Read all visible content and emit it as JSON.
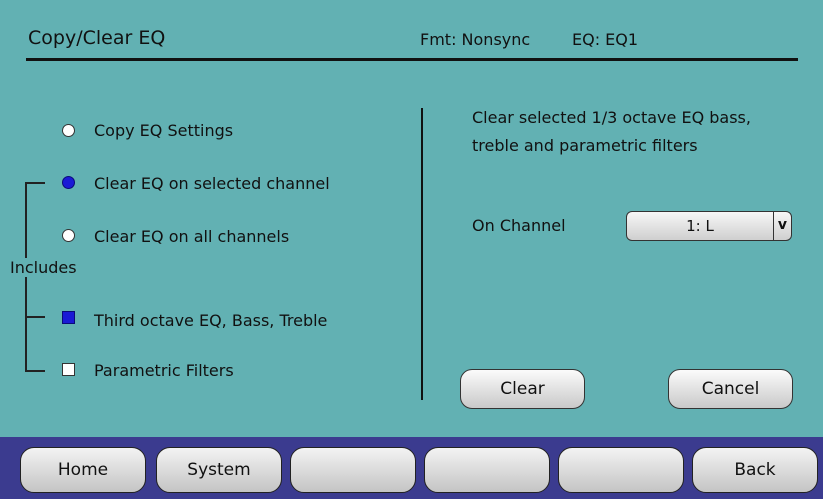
{
  "header": {
    "title": "Copy/Clear EQ",
    "format": "Fmt: Nonsync",
    "eq": "EQ: EQ1"
  },
  "options": [
    {
      "label": "Copy EQ Settings",
      "selected": false
    },
    {
      "label": "Clear EQ on selected channel",
      "selected": true
    },
    {
      "label": "Clear EQ on all channels",
      "selected": false
    }
  ],
  "includes_label": "Includes",
  "includes": [
    {
      "label": "Third octave EQ, Bass, Treble",
      "checked": true
    },
    {
      "label": "Parametric Filters",
      "checked": false
    }
  ],
  "description": "Clear selected 1/3 octave EQ bass, treble and parametric filters",
  "channel": {
    "label": "On Channel",
    "value": "1: L",
    "arrow": "v"
  },
  "actions": {
    "clear": "Clear",
    "cancel": "Cancel"
  },
  "nav": [
    "Home",
    "System",
    "",
    "",
    "",
    "Back"
  ],
  "colors": {
    "background": "#62b1b3",
    "selected": "#1a1ad6",
    "bottom_bar": "#3b3b8f"
  }
}
